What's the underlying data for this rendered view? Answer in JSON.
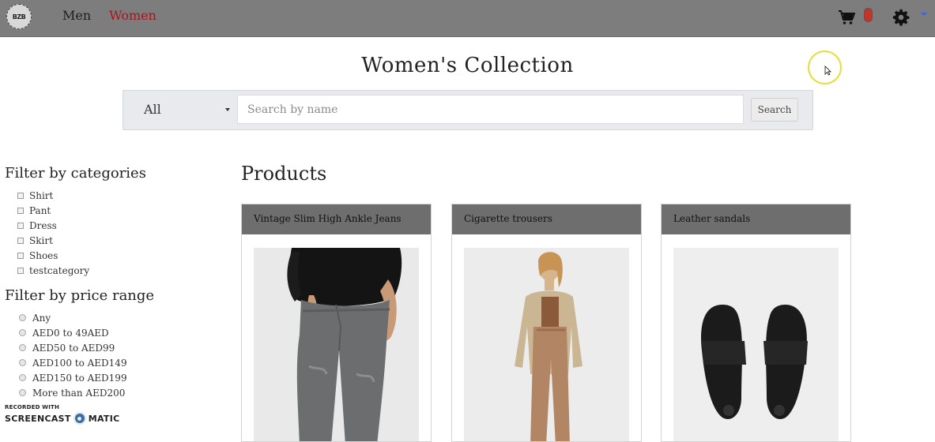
{
  "navbar": {
    "logo_text": "BZB",
    "links": [
      {
        "label": "Men",
        "active": false
      },
      {
        "label": "Women",
        "active": true
      }
    ],
    "colors": {
      "bar": "#7d7d7d",
      "active_link": "#a8151b"
    },
    "icons": [
      "cart-icon",
      "gear-icon",
      "caret-down-icon"
    ]
  },
  "page": {
    "title": "Women's Collection"
  },
  "search": {
    "category_value": "All",
    "placeholder": "Search by name",
    "value": "",
    "button_label": "Search"
  },
  "filters": {
    "categories_heading": "Filter by categories",
    "categories": [
      "Shirt",
      "Pant",
      "Dress",
      "Skirt",
      "Shoes",
      "testcategory"
    ],
    "price_heading": "Filter by price range",
    "price_ranges": [
      "Any",
      "AED0 to 49AED",
      "AED50 to AED99",
      "AED100 to AED149",
      "AED150 to AED199",
      "More than AED200"
    ]
  },
  "products": {
    "heading": "Products",
    "items": [
      {
        "name": "Vintage Slim High Ankle Jeans",
        "image": "jeans-photo"
      },
      {
        "name": "Cigarette trousers",
        "image": "trousers-photo"
      },
      {
        "name": "Leather sandals",
        "image": "sandals-photo"
      }
    ]
  },
  "watermark": {
    "line1": "RECORDED WITH",
    "left": "SCREENCAST",
    "right": "MATIC"
  }
}
